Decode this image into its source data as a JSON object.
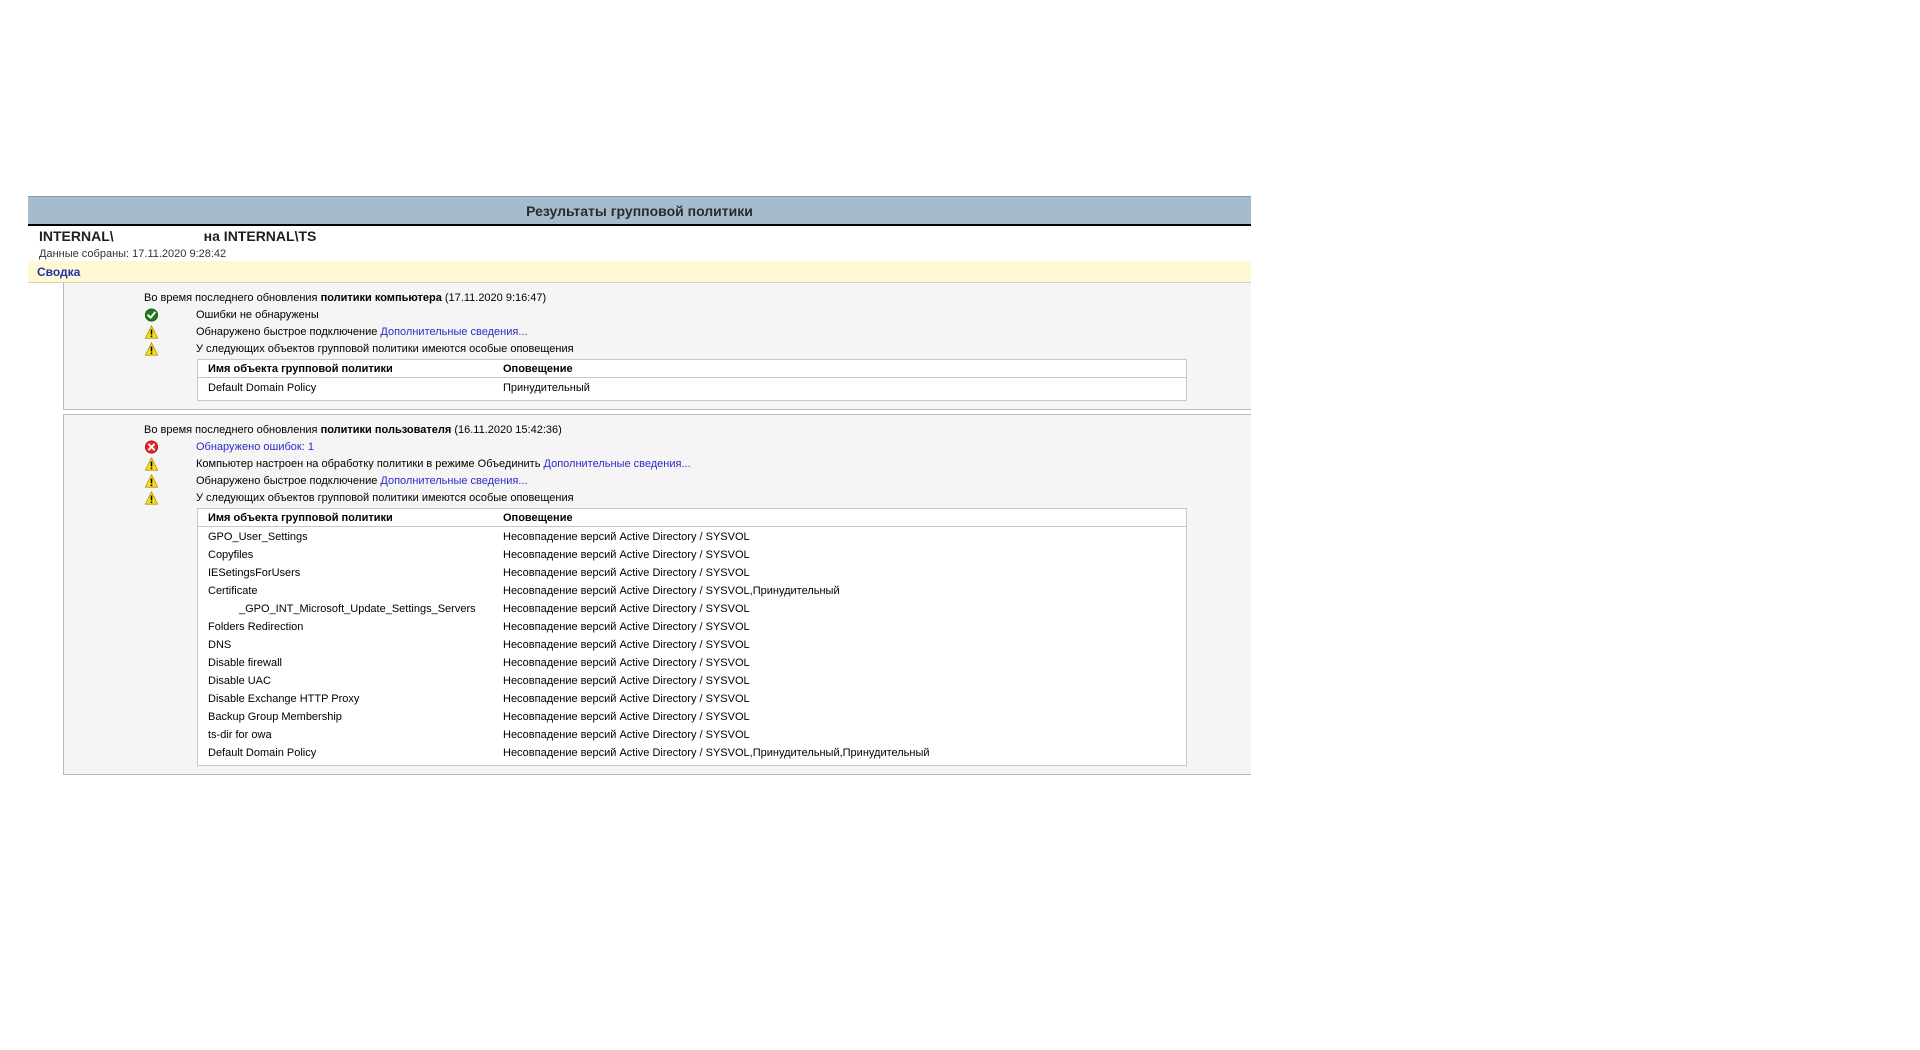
{
  "report": {
    "title": "Результаты групповой политики",
    "subject_left": "INTERNAL\\",
    "subject_right": "на INTERNAL\\TS",
    "collected": "Данные собраны: 17.11.2020 9:28:42",
    "summary_label": "Сводка"
  },
  "computer": {
    "head_prefix": "Во время последнего обновления ",
    "head_bold": "политики компьютера",
    "head_suffix": " (17.11.2020 9:16:47)",
    "messages": [
      {
        "icon": "success-check-icon",
        "text": "Ошибки не обнаружены",
        "link": ""
      },
      {
        "icon": "warning-icon",
        "text": "Обнаружено быстрое подключение ",
        "link": "Дополнительные сведения..."
      },
      {
        "icon": "warning-icon",
        "text": "У следующих объектов групповой политики имеются особые оповещения",
        "link": ""
      }
    ],
    "table": {
      "col_name": "Имя объекта групповой политики",
      "col_alert": "Оповещение",
      "rows": [
        {
          "name": "Default Domain Policy",
          "alert": "Принудительный"
        }
      ]
    }
  },
  "user": {
    "head_prefix": "Во время последнего обновления ",
    "head_bold": "политики пользователя",
    "head_suffix": " (16.11.2020 15:42:36)",
    "messages": [
      {
        "icon": "error-icon",
        "text": "",
        "link": "Обнаружено ошибок: 1"
      },
      {
        "icon": "warning-icon",
        "text": "Компьютер настроен на обработку политики в режиме Объединить ",
        "link": "Дополнительные сведения..."
      },
      {
        "icon": "warning-icon",
        "text": "Обнаружено быстрое подключение ",
        "link": "Дополнительные сведения..."
      },
      {
        "icon": "warning-icon",
        "text": "У следующих объектов групповой политики имеются особые оповещения",
        "link": ""
      }
    ],
    "table": {
      "col_name": "Имя объекта групповой политики",
      "col_alert": "Оповещение",
      "rows": [
        {
          "name": "GPO_User_Settings",
          "alert": "Несовпадение версий Active Directory / SYSVOL"
        },
        {
          "name": "Copyfiles",
          "alert": "Несовпадение версий Active Directory / SYSVOL"
        },
        {
          "name": "IESetingsForUsers",
          "alert": "Несовпадение версий Active Directory / SYSVOL"
        },
        {
          "name": "Certificate",
          "alert": "Несовпадение версий Active Directory / SYSVOL,Принудительный"
        },
        {
          "name": "_GPO_INT_Microsoft_Update_Settings_Servers",
          "alert": "Несовпадение версий Active Directory / SYSVOL"
        },
        {
          "name": "Folders Redirection",
          "alert": "Несовпадение версий Active Directory / SYSVOL"
        },
        {
          "name": "DNS",
          "alert": "Несовпадение версий Active Directory / SYSVOL"
        },
        {
          "name": "Disable firewall",
          "alert": "Несовпадение версий Active Directory / SYSVOL"
        },
        {
          "name": "Disable UAC",
          "alert": "Несовпадение версий Active Directory / SYSVOL"
        },
        {
          "name": "Disable Exchange HTTP Proxy",
          "alert": "Несовпадение версий Active Directory / SYSVOL"
        },
        {
          "name": "Backup Group Membership",
          "alert": "Несовпадение версий Active Directory / SYSVOL"
        },
        {
          "name": "ts-dir for owa",
          "alert": "Несовпадение версий Active Directory / SYSVOL"
        },
        {
          "name": "Default Domain Policy",
          "alert": "Несовпадение версий Active Directory / SYSVOL,Принудительный,Принудительный"
        }
      ]
    }
  }
}
